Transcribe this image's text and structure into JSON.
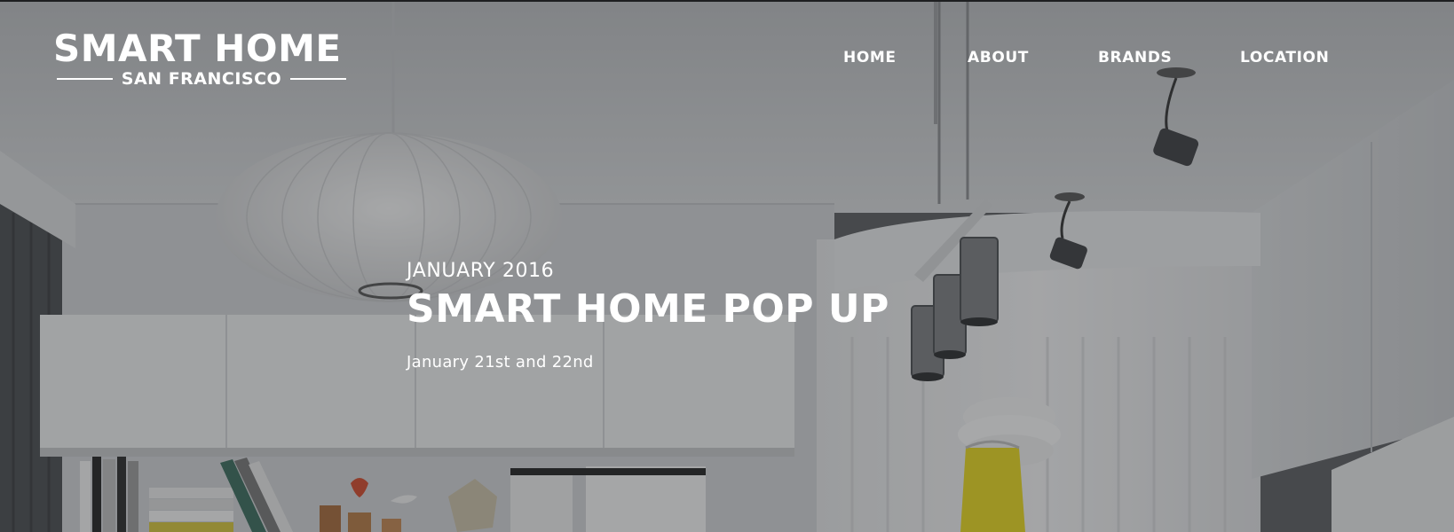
{
  "brand": {
    "title": "SMART HOME",
    "subtitle": "SAN FRANCISCO"
  },
  "nav": {
    "items": [
      {
        "label": "HOME"
      },
      {
        "label": "ABOUT"
      },
      {
        "label": "BRANDS"
      },
      {
        "label": "LOCATION"
      }
    ]
  },
  "hero": {
    "eyebrow": "JANUARY 2016",
    "title": "SMART HOME POP UP",
    "dates": "January 21st and 22nd"
  },
  "colors": {
    "text": "#ffffff",
    "overlay": "#3a3c40",
    "accent_yellow": "#e8d21a"
  }
}
